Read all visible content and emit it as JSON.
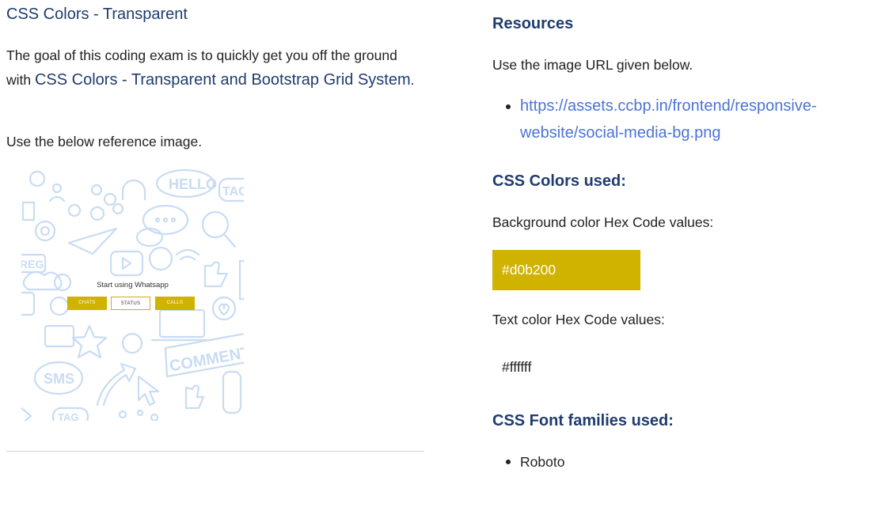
{
  "left": {
    "title": "CSS Colors - Transparent",
    "intro_before": "The goal of this coding exam is to quickly get you off the ground with ",
    "intro_highlight": "CSS Colors - Transparent and Bootstrap Grid System",
    "intro_after": ".",
    "reference_text": "Use the below reference image.",
    "preview": {
      "heading": "Start using Whatsapp",
      "buttons": [
        "CHATS",
        "STATUS",
        "CALLS"
      ],
      "doodle_words": [
        "HELLO",
        "TAG",
        "REG",
        "COMMENT",
        "SMS",
        "TAG"
      ]
    }
  },
  "right": {
    "resources_heading": "Resources",
    "use_image_text": "Use the image URL given below.",
    "image_url": "https://assets.ccbp.in/frontend/responsive-website/social-media-bg.png",
    "colors_heading": "CSS Colors used:",
    "bg_label": "Background color Hex Code values:",
    "bg_hex": "#d0b200",
    "text_label": "Text color Hex Code values:",
    "text_hex": "#ffffff",
    "fonts_heading": "CSS Font families used:",
    "fonts": [
      "Roboto"
    ]
  },
  "colors": {
    "accent": "#d0b200",
    "heading": "#1f3c6e",
    "link": "#4b73d8",
    "doodle": "#c9dcf3"
  }
}
